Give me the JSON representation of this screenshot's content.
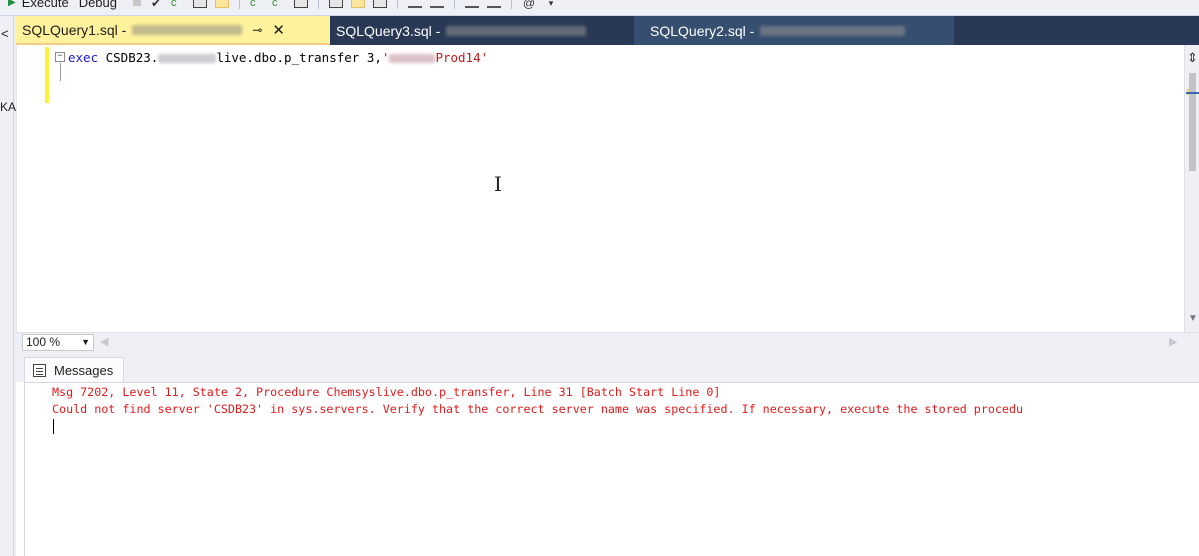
{
  "toolbar": {
    "execute_label": "Execute",
    "debug_label": "Debug"
  },
  "tabs": [
    {
      "label": "SQLQuery1.sql - ",
      "active": true,
      "pinned": true
    },
    {
      "label": "SQLQuery3.sql - ",
      "active": false
    },
    {
      "label": "SQLQuery2.sql - ",
      "active": false
    }
  ],
  "leftstrip": {
    "text": "KA"
  },
  "editor": {
    "keyword": "exec",
    "code_part1": " CSDB23.",
    "code_part2": "live.dbo.p_transfer 3,",
    "string_open": "'",
    "string_part": "Prod14'"
  },
  "zoom": {
    "value": "100 %"
  },
  "results": {
    "tab_label": "Messages",
    "lines": [
      "Msg 7202, Level 11, State 2, Procedure Chemsyslive.dbo.p_transfer, Line 31 [Batch Start Line 0]",
      "Could not find server 'CSDB23' in sys.servers. Verify that the correct server name was specified. If necessary, execute the stored procedu"
    ]
  },
  "colors": {
    "tab_strip": "#293955",
    "active_tab": "#fff29d",
    "error_text": "#e01b1b",
    "keyword": "#1a1acc",
    "string": "#c11a1a"
  }
}
